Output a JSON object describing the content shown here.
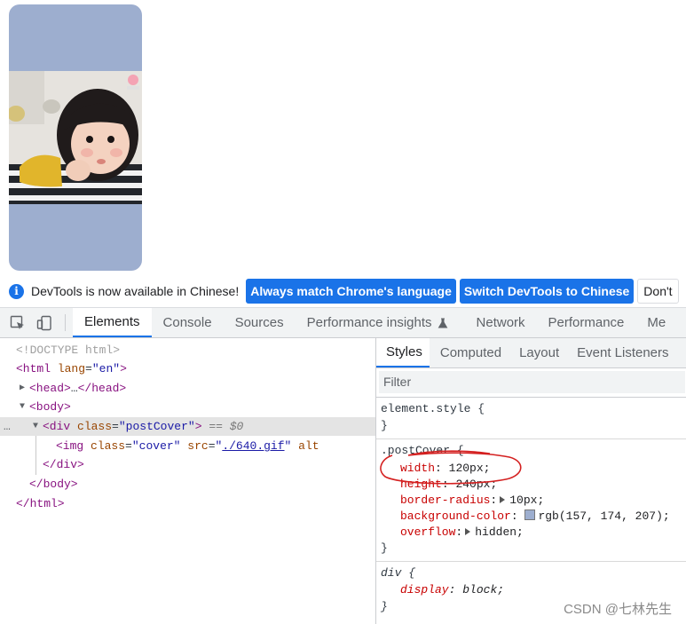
{
  "infobar": {
    "message": "DevTools is now available in Chinese!",
    "buttons": [
      "Always match Chrome's language",
      "Switch DevTools to Chinese",
      "Don't"
    ]
  },
  "tabs": [
    "Elements",
    "Console",
    "Sources",
    "Performance insights",
    "Network",
    "Performance",
    "Me"
  ],
  "elements": {
    "doctype": "<!DOCTYPE html>",
    "html_open_tag": "<html",
    "html_lang_attr": "lang",
    "html_lang_val": "\"en\"",
    "gt": ">",
    "head_open": "<head>",
    "ellipsis": "…",
    "head_close": "</head>",
    "body_open": "<body>",
    "div_open": "<div",
    "class_attr": "class",
    "eq": "=",
    "div_class_val": "\"postCover\"",
    "selected_marker": "== $0",
    "img_open": "<img",
    "img_class_val": "\"cover\"",
    "src_attr": "src",
    "src_val": "./640.gif",
    "quote": "\"",
    "alt_attr": "alt",
    "div_close": "</div>",
    "body_close": "</body>",
    "html_close": "</html>",
    "dots": "…"
  },
  "styles": {
    "tabs": [
      "Styles",
      "Computed",
      "Layout",
      "Event Listeners"
    ],
    "filter_placeholder": "Filter",
    "element_style": "element.style {",
    "close_brace": "}",
    "post_cover_selector": ".postCover {",
    "rules": [
      {
        "name": "width",
        "value": "120px;"
      },
      {
        "name": "height",
        "value": "240px;"
      },
      {
        "name": "border-radius",
        "value": "10px;"
      },
      {
        "name": "background-color",
        "value": "rgb(157, 174, 207);"
      },
      {
        "name": "overflow",
        "value": "hidden;"
      }
    ],
    "div_selector": "div {",
    "div_rule": {
      "name": "display",
      "value": "block;"
    },
    "colon": ":"
  },
  "watermark": "CSDN @七林先生",
  "colors": {
    "accent": "#1a73e8",
    "post_bg": "#9daecf",
    "annotation": "#d42020"
  }
}
